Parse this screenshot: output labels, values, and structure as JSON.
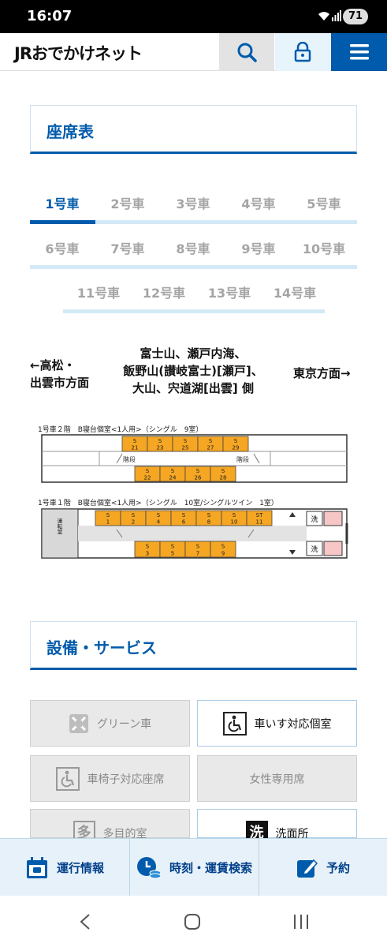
{
  "status_bar": {
    "time": "16:07",
    "battery": "71"
  },
  "header": {
    "logo": "JRおでかけネット"
  },
  "seat_section": {
    "title": "座席表"
  },
  "car_tabs": [
    "1号車",
    "2号車",
    "3号車",
    "4号車",
    "5号車",
    "6号車",
    "7号車",
    "8号車",
    "9号車",
    "10号車",
    "11号車",
    "12号車",
    "13号車",
    "14号車"
  ],
  "active_tab": "1号車",
  "directions": {
    "left_line1": "←高松・",
    "left_line2": "出雲市方面",
    "center_line1": "富士山、瀬戸内海、",
    "center_line2": "飯野山(讃岐富士)[瀬戸]、",
    "center_line3": "大山、宍道湖[出雲] 側",
    "right": "東京方面→"
  },
  "seat_map": {
    "upper_label": "1号車２階　B寝台個室<1人用>（シングル　9室）",
    "upper_top_seats": [
      {
        "s": "S",
        "n": "21"
      },
      {
        "s": "S",
        "n": "23"
      },
      {
        "s": "S",
        "n": "25"
      },
      {
        "s": "S",
        "n": "27"
      },
      {
        "s": "S",
        "n": "29"
      }
    ],
    "upper_bottom_seats": [
      {
        "s": "S",
        "n": "22"
      },
      {
        "s": "S",
        "n": "24"
      },
      {
        "s": "S",
        "n": "26"
      },
      {
        "s": "S",
        "n": "28"
      }
    ],
    "stairs_label": "階段",
    "lower_label": "1号車１階　B寝台個室<1人用>（シングル　10室/シングルツイン　1室）",
    "cab_label": "運転室",
    "lower_top_seats": [
      {
        "s": "S",
        "n": "1"
      },
      {
        "s": "S",
        "n": "2"
      },
      {
        "s": "S",
        "n": "4"
      },
      {
        "s": "S",
        "n": "6"
      },
      {
        "s": "S",
        "n": "8"
      },
      {
        "s": "S",
        "n": "10"
      },
      {
        "s": "ST",
        "n": "11"
      }
    ],
    "lower_bottom_seats": [
      {
        "s": "S",
        "n": "3"
      },
      {
        "s": "S",
        "n": "5"
      },
      {
        "s": "S",
        "n": "7"
      },
      {
        "s": "S",
        "n": "9"
      }
    ],
    "wash_label": "洗",
    "seat_color": "#f5a623"
  },
  "facilities_section": {
    "title": "設備・サービス"
  },
  "facilities": [
    {
      "label": "グリーン車",
      "enabled": false,
      "icon": "green-car-icon"
    },
    {
      "label": "車いす対応個室",
      "enabled": true,
      "icon": "wheelchair-icon"
    },
    {
      "label": "車椅子対応座席",
      "enabled": false,
      "icon": "wheelchair-icon"
    },
    {
      "label": "女性専用席",
      "enabled": false,
      "icon": ""
    },
    {
      "label": "多目的室",
      "enabled": false,
      "icon": "multipurpose-icon",
      "glyph": "多"
    },
    {
      "label": "洗面所",
      "enabled": true,
      "icon": "washroom-icon",
      "glyph": "洗"
    }
  ],
  "bottom_nav": {
    "service_info": "運行情報",
    "timetable": "時刻・運賃検索",
    "reserve": "予約"
  },
  "colors": {
    "brand_blue": "#005bac",
    "seat_orange": "#f5a623"
  }
}
